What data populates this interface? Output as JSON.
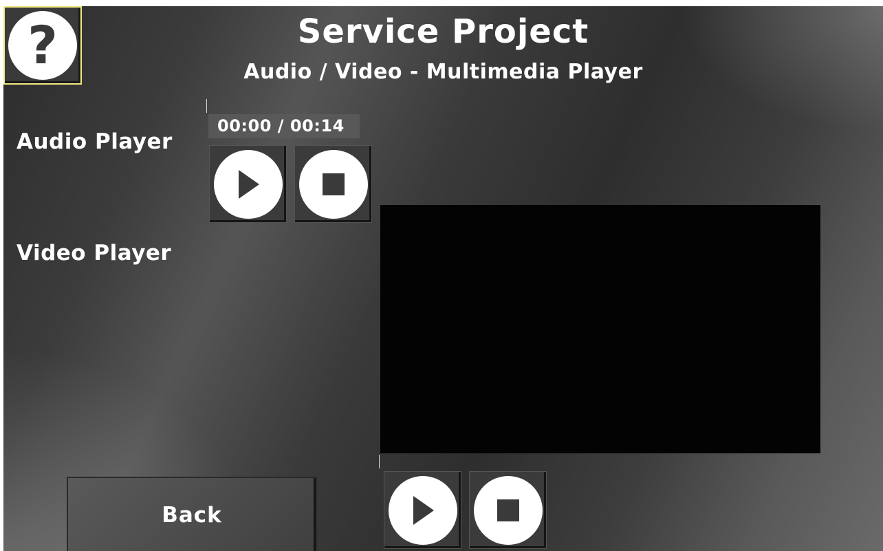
{
  "header": {
    "title": "Service Project",
    "subtitle": "Audio / Video - Multimedia Player"
  },
  "help_button": {
    "glyph": "?",
    "icon": "question-mark-icon"
  },
  "audio_player": {
    "label": "Audio Player",
    "time_display": "00:00 / 00:14",
    "play_icon": "play-icon",
    "stop_icon": "stop-icon"
  },
  "video_player": {
    "label": "Video Player",
    "play_icon": "play-icon",
    "stop_icon": "stop-icon"
  },
  "footer": {
    "back_label": "Back"
  },
  "colors": {
    "help_border": "#f2ea80",
    "video_background": "#030304",
    "text": "#ffffff"
  }
}
